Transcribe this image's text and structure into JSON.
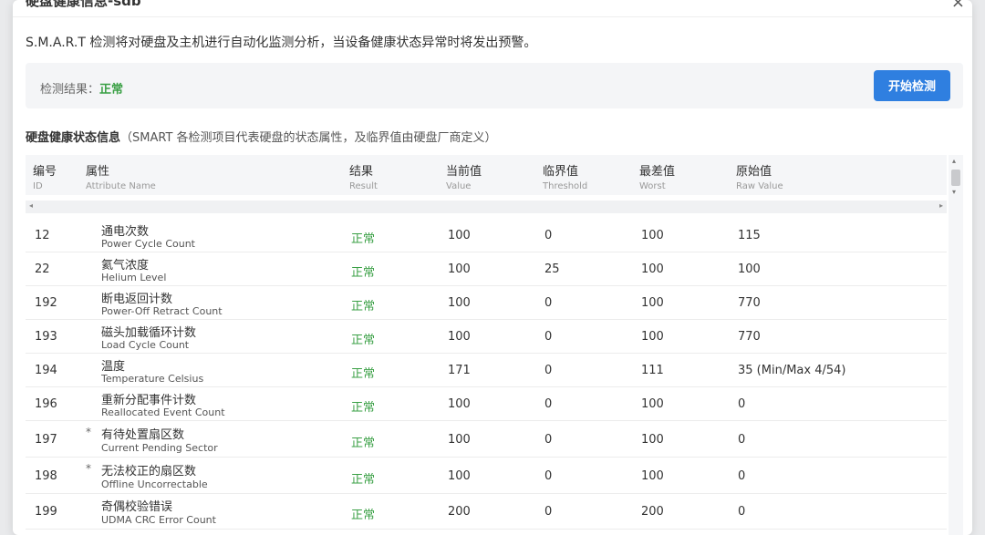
{
  "dialog": {
    "title": "硬盘健康信息-sdb",
    "close_label": "×"
  },
  "intro": "S.M.A.R.T 检测将对硬盘及主机进行自动化监测分析，当设备健康状态异常时将发出预警。",
  "check": {
    "label": "检测结果：",
    "value": "正常",
    "button_label": "开始检测"
  },
  "section": {
    "title": "硬盘健康状态信息",
    "desc": "（SMART 各检测项目代表硬盘的状态属性，及临界值由硬盘厂商定义）"
  },
  "columns": [
    {
      "cn": "编号",
      "en": "ID"
    },
    {
      "cn": "属性",
      "en": "Attribute Name"
    },
    {
      "cn": "结果",
      "en": "Result"
    },
    {
      "cn": "当前值",
      "en": "Value"
    },
    {
      "cn": "临界值",
      "en": "Threshold"
    },
    {
      "cn": "最差值",
      "en": "Worst"
    },
    {
      "cn": "原始值",
      "en": "Raw Value"
    }
  ],
  "rows": [
    {
      "id": "12",
      "star": "",
      "name_cn": "通电次数",
      "name_en": "Power Cycle Count",
      "result": "正常",
      "value": "100",
      "threshold": "0",
      "worst": "100",
      "raw": "115"
    },
    {
      "id": "22",
      "star": "",
      "name_cn": "氦气浓度",
      "name_en": "Helium Level",
      "result": "正常",
      "value": "100",
      "threshold": "25",
      "worst": "100",
      "raw": "100"
    },
    {
      "id": "192",
      "star": "",
      "name_cn": "断电返回计数",
      "name_en": "Power-Off Retract Count",
      "result": "正常",
      "value": "100",
      "threshold": "0",
      "worst": "100",
      "raw": "770"
    },
    {
      "id": "193",
      "star": "",
      "name_cn": "磁头加载循环计数",
      "name_en": "Load Cycle Count",
      "result": "正常",
      "value": "100",
      "threshold": "0",
      "worst": "100",
      "raw": "770"
    },
    {
      "id": "194",
      "star": "",
      "name_cn": "温度",
      "name_en": "Temperature Celsius",
      "result": "正常",
      "value": "171",
      "threshold": "0",
      "worst": "111",
      "raw": "35 (Min/Max 4/54)"
    },
    {
      "id": "196",
      "star": "",
      "name_cn": "重新分配事件计数",
      "name_en": "Reallocated Event Count",
      "result": "正常",
      "value": "100",
      "threshold": "0",
      "worst": "100",
      "raw": "0"
    },
    {
      "id": "197",
      "star": "*",
      "name_cn": "有待处置扇区数",
      "name_en": "Current Pending Sector",
      "result": "正常",
      "value": "100",
      "threshold": "0",
      "worst": "100",
      "raw": "0"
    },
    {
      "id": "198",
      "star": "*",
      "name_cn": "无法校正的扇区数",
      "name_en": "Offline Uncorrectable",
      "result": "正常",
      "value": "100",
      "threshold": "0",
      "worst": "100",
      "raw": "0"
    },
    {
      "id": "199",
      "star": "",
      "name_cn": "奇偶校验错误",
      "name_en": "UDMA CRC Error Count",
      "result": "正常",
      "value": "200",
      "threshold": "0",
      "worst": "200",
      "raw": "0"
    }
  ],
  "colors": {
    "accent": "#2f7fe0",
    "ok": "#3aa045"
  },
  "icons": {
    "scroll_left": "◂",
    "scroll_right": "▸",
    "scroll_up": "▴",
    "scroll_down": "▾"
  }
}
